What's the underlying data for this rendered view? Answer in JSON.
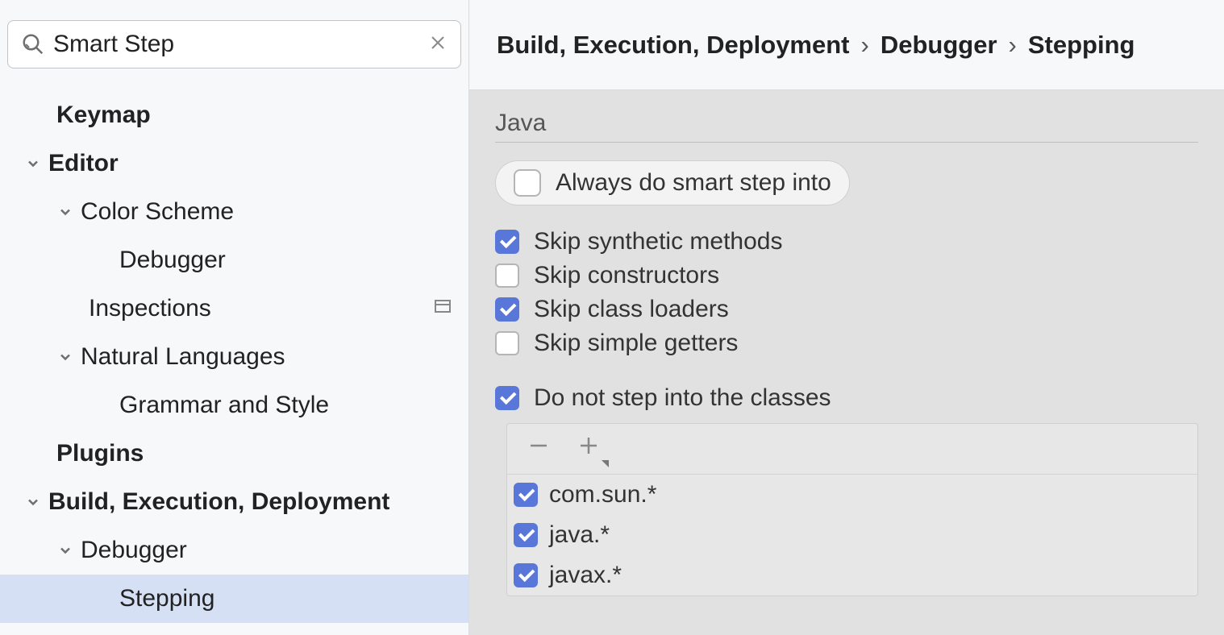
{
  "search": {
    "value": "Smart Step"
  },
  "tree": {
    "keymap": "Keymap",
    "editor": "Editor",
    "color_scheme": "Color Scheme",
    "cs_debugger": "Debugger",
    "inspections": "Inspections",
    "natural_languages": "Natural Languages",
    "grammar": "Grammar and Style",
    "plugins": "Plugins",
    "bed": "Build, Execution, Deployment",
    "bed_debugger": "Debugger",
    "stepping": "Stepping"
  },
  "breadcrumb": {
    "a": "Build, Execution, Deployment",
    "b": "Debugger",
    "c": "Stepping"
  },
  "section": "Java",
  "options": {
    "always_smart_step": "Always do smart step into",
    "skip_synthetic": "Skip synthetic methods",
    "skip_constructors": "Skip constructors",
    "skip_class_loaders": "Skip class loaders",
    "skip_simple_getters": "Skip simple getters",
    "do_not_step": "Do not step into the classes"
  },
  "classes": [
    "com.sun.*",
    "java.*",
    "javax.*"
  ]
}
